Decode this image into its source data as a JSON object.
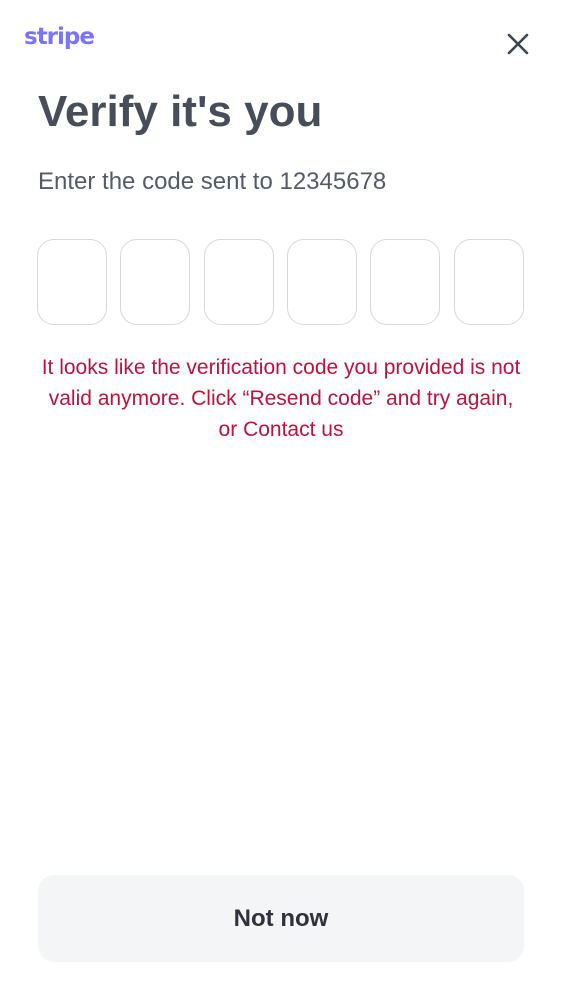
{
  "header": {
    "logo_text": "stripe",
    "close_icon": "close-icon",
    "brand_color": "#7a73ff"
  },
  "main": {
    "title": "Verify it's you",
    "subtitle": "Enter the code sent to 12345678",
    "otp_digits": [
      "",
      "",
      "",
      "",
      "",
      ""
    ],
    "error": {
      "text_before": "It looks like the verification code you provided is not valid anymore. Click “Resend code” and try again, or ",
      "link_label": "Contact us",
      "color": "#c0123c"
    }
  },
  "footer": {
    "not_now_label": "Not now"
  }
}
